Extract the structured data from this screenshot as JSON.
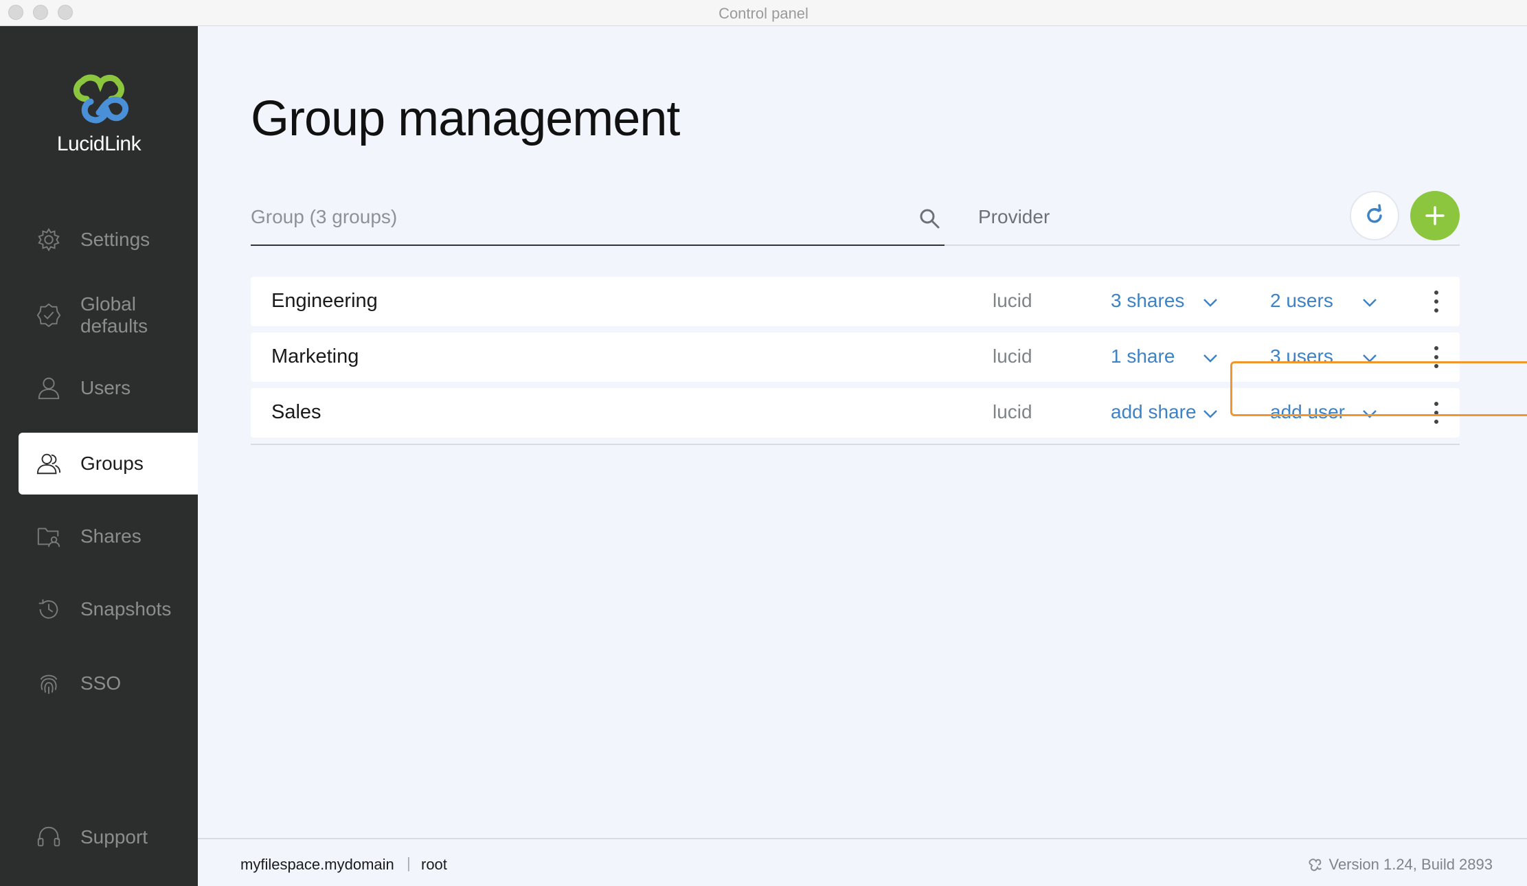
{
  "window": {
    "title": "Control panel"
  },
  "brand": {
    "name": "LucidLink",
    "colors": {
      "green": "#8cc63f",
      "blue": "#4a90d9"
    }
  },
  "sidebar": {
    "items": [
      {
        "label": "Settings",
        "icon": "gear-icon"
      },
      {
        "label": "Global\ndefaults",
        "icon": "badge-check-icon"
      },
      {
        "label": "Users",
        "icon": "user-icon"
      },
      {
        "label": "Groups",
        "icon": "group-icon",
        "active": true
      },
      {
        "label": "Shares",
        "icon": "shared-folder-icon"
      },
      {
        "label": "Snapshots",
        "icon": "history-icon"
      },
      {
        "label": "SSO",
        "icon": "fingerprint-icon"
      }
    ],
    "support": {
      "label": "Support",
      "icon": "headset-icon"
    }
  },
  "main": {
    "title": "Group management",
    "search": {
      "placeholder": "Group (3 groups)",
      "value": ""
    },
    "columns": {
      "provider": "Provider"
    },
    "groups": [
      {
        "name": "Engineering",
        "provider": "lucid",
        "shares": "3 shares",
        "users": "2 users"
      },
      {
        "name": "Marketing",
        "provider": "lucid",
        "shares": "1 share",
        "users": "3 users"
      },
      {
        "name": "Sales",
        "provider": "lucid",
        "shares": "add share",
        "users": "add user"
      }
    ]
  },
  "footer": {
    "domain": "myfilespace.mydomain",
    "separator": "|",
    "user": "root",
    "version": "Version 1.24, Build 2893"
  },
  "colors": {
    "accent_link": "#3d82c6",
    "highlight": "#f0962a",
    "sidebar_bg": "#2c2e2d"
  }
}
